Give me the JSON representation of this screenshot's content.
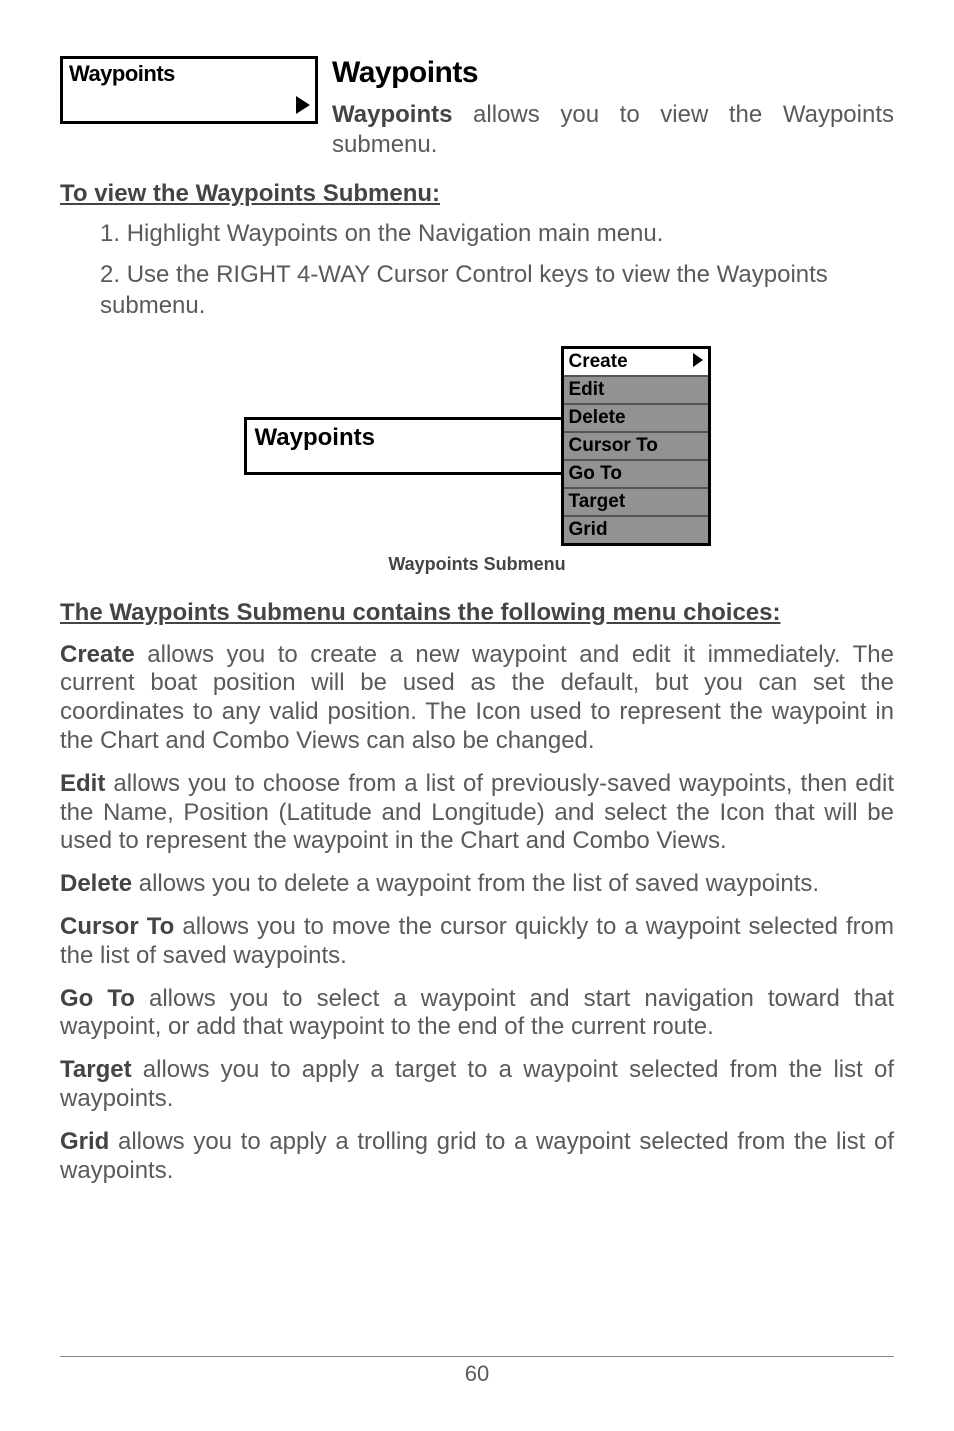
{
  "top_box_label": "Waypoints",
  "section_title": "Waypoints",
  "intro_bold": "Waypoints",
  "intro_rest": " allows you to view the Waypoints submenu.",
  "procedure_heading": "To view the Waypoints Submenu:",
  "steps": {
    "s1_prefix": "1.  ",
    "s1_text": "Highlight Waypoints on the Navigation main menu.",
    "s2_prefix": "2.  ",
    "s2_text": "Use the RIGHT 4-WAY Cursor Control keys to view the Waypoints submenu."
  },
  "figure": {
    "box_label": "Waypoints",
    "submenu": {
      "create": "Create",
      "edit": "Edit",
      "delete": "Delete",
      "cursor_to": "Cursor To",
      "go_to": "Go To",
      "target": "Target",
      "grid": "Grid"
    },
    "caption": "Waypoints Submenu"
  },
  "choices_heading": "The Waypoints Submenu contains the following menu choices:",
  "paras": {
    "create_b": "Create",
    "create_t": " allows you to create a new waypoint and edit it immediately.  The current boat position will be used as the default, but you can set the coordinates to any valid position. The Icon used to represent the waypoint in the Chart and Combo Views can also be changed.",
    "edit_b": "Edit",
    "edit_t": " allows you to choose from a list of previously-saved waypoints, then edit the Name, Position (Latitude and Longitude) and select the Icon that will be used to represent the waypoint in the Chart and Combo Views.",
    "delete_b": "Delete",
    "delete_t": " allows you to delete a waypoint from the list of saved waypoints.",
    "cursor_b": "Cursor To",
    "cursor_t": " allows you to move the cursor quickly to a waypoint selected from the list of saved waypoints.",
    "goto_b": "Go To",
    "goto_t": " allows you to select a waypoint and start navigation toward that waypoint, or add that waypoint to the end of the current route.",
    "target_b": "Target",
    "target_t": " allows you to apply a target to a waypoint selected from the list of waypoints.",
    "grid_b": "Grid",
    "grid_t": " allows you to apply a trolling grid to a waypoint selected from the list of waypoints."
  },
  "page_number": "60"
}
